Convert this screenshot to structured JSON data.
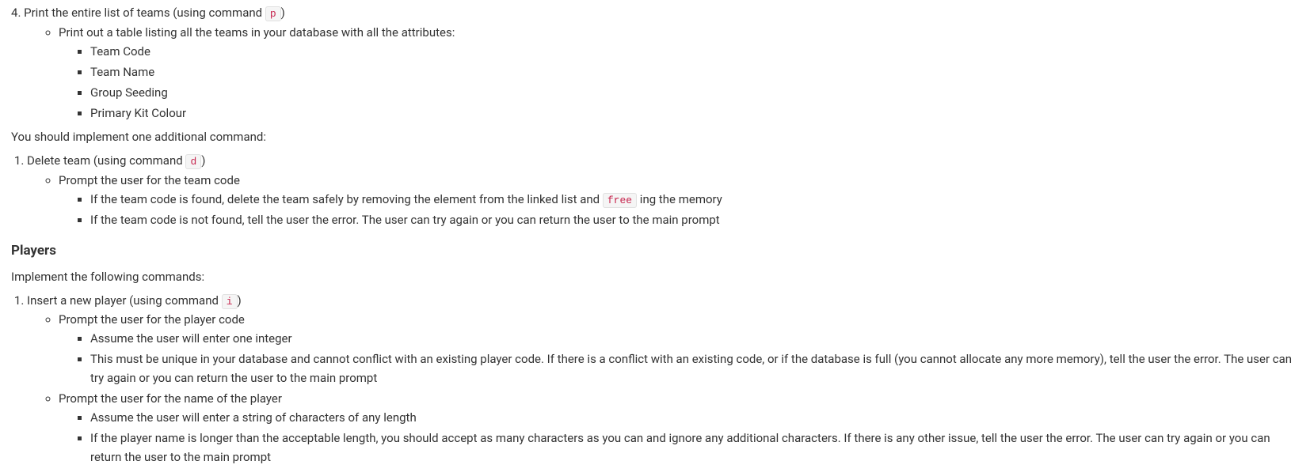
{
  "item4": {
    "text_before": "Print the entire list of teams (using command ",
    "code": "p",
    "text_after": ")",
    "sub1": "Print out a table listing all the teams in your database with all the attributes:",
    "attrs": [
      "Team Code",
      "Team Name",
      "Group Seeding",
      "Primary Kit Colour"
    ]
  },
  "para1": "You should implement one additional command:",
  "delete_item": {
    "text_before": "Delete team (using command ",
    "code": "d",
    "text_after": ")",
    "sub1": "Prompt the user for the team code",
    "found_before": "If the team code is found, delete the team safely by removing the element from the linked list and ",
    "found_code": "free",
    "found_after": " ing the memory",
    "notfound": "If the team code is not found, tell the user the error. The user can try again or you can return the user to the main prompt"
  },
  "players_heading": "Players",
  "para2": "Implement the following commands:",
  "insert_item": {
    "text_before": "Insert a new player (using command ",
    "code": "i",
    "text_after": ")",
    "sub1": "Prompt the user for the player code",
    "sub1_a": "Assume the user will enter one integer",
    "sub1_b": "This must be unique in your database and cannot conflict with an existing player code. If there is a conflict with an existing code, or if the database is full (you cannot allocate any more memory), tell the user the error. The user can try again or you can return the user to the main prompt",
    "sub2": "Prompt the user for the name of the player",
    "sub2_a": "Assume the user will enter a string of characters of any length",
    "sub2_b": "If the player name is longer than the acceptable length, you should accept as many characters as you can and ignore any additional characters. If there is any other issue, tell the user the error. The user can try again or you can return the user to the main prompt"
  }
}
